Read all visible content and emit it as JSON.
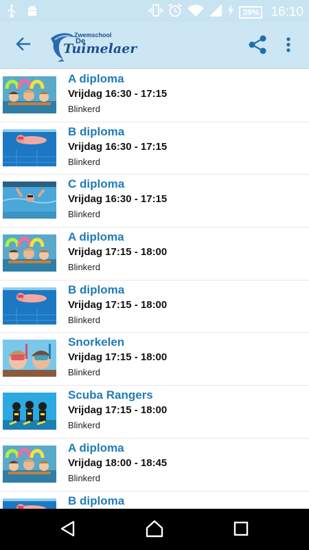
{
  "status_bar": {
    "left_icons": [
      "usb-icon",
      "android-icon"
    ],
    "right_icons": [
      "vibrate-icon",
      "alarm-icon",
      "wifi-icon",
      "signal-icon",
      "charging-icon"
    ],
    "battery": "39%",
    "time": "16:10"
  },
  "app_bar": {
    "back_icon": "arrow-left-icon",
    "logo": {
      "small_text": "Zwemschool",
      "de_text": "De",
      "name": "Tuimelaer"
    },
    "share_icon": "share-icon",
    "more_icon": "more-vert-icon"
  },
  "lessons": [
    {
      "title": "A diploma",
      "time": "Vrijdag 16:30 - 17:15",
      "location": "Blinkerd",
      "image": "a"
    },
    {
      "title": "B diploma",
      "time": "Vrijdag 16:30 - 17:15",
      "location": "Blinkerd",
      "image": "b"
    },
    {
      "title": "C diploma",
      "time": "Vrijdag 16:30 - 17:15",
      "location": "Blinkerd",
      "image": "c"
    },
    {
      "title": "A diploma",
      "time": "Vrijdag 17:15 - 18:00",
      "location": "Blinkerd",
      "image": "a"
    },
    {
      "title": "B diploma",
      "time": "Vrijdag 17:15 - 18:00",
      "location": "Blinkerd",
      "image": "b"
    },
    {
      "title": "Snorkelen",
      "time": "Vrijdag 17:15 - 18:00",
      "location": "Blinkerd",
      "image": "snorkel"
    },
    {
      "title": "Scuba Rangers",
      "time": "Vrijdag 17:15 - 18:00",
      "location": "Blinkerd",
      "image": "scuba"
    },
    {
      "title": "A diploma",
      "time": "Vrijdag 18:00 - 18:45",
      "location": "Blinkerd",
      "image": "a"
    },
    {
      "title": "B diploma",
      "time": "",
      "location": "",
      "image": "b"
    }
  ],
  "nav_bar": {
    "icons": [
      "back-triangle-icon",
      "home-icon",
      "recents-icon"
    ]
  },
  "colors": {
    "accent": "#1f7bb6",
    "app_bar": "#cde6f3",
    "status_bar": "#c9e4f1",
    "nav_bar": "#000000"
  }
}
